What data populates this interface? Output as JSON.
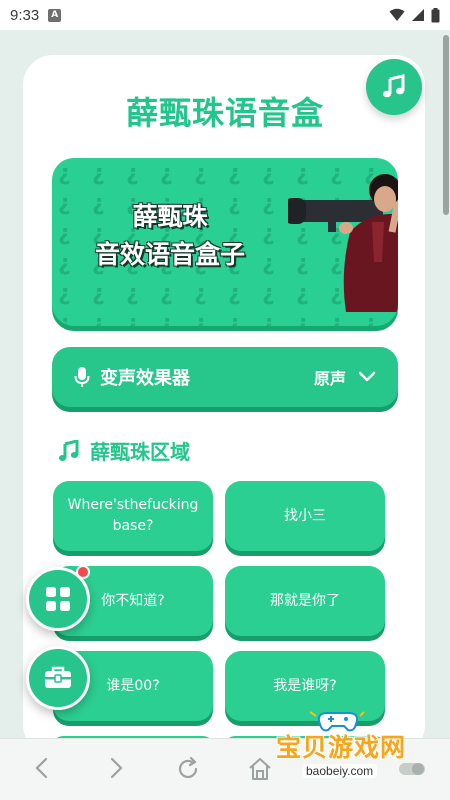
{
  "status_bar": {
    "time": "9:33",
    "notification_icon": "A"
  },
  "app": {
    "title": "薛甄珠语音盒",
    "accent_color": "#27c48c"
  },
  "banner": {
    "line1": "薛甄珠",
    "line2": "音效语音盒子"
  },
  "voice_changer": {
    "label": "变声效果器",
    "value": "原声"
  },
  "section": {
    "title": "薛甄珠区域"
  },
  "sounds": [
    {
      "label": "Where'sthefucking base?"
    },
    {
      "label": "找小三"
    },
    {
      "label": "你不知道?"
    },
    {
      "label": "那就是你了"
    },
    {
      "label": "谁是00?"
    },
    {
      "label": "我是谁呀?"
    }
  ],
  "watermark": {
    "title": "宝贝游戏网",
    "url": "baobeiy.com"
  }
}
